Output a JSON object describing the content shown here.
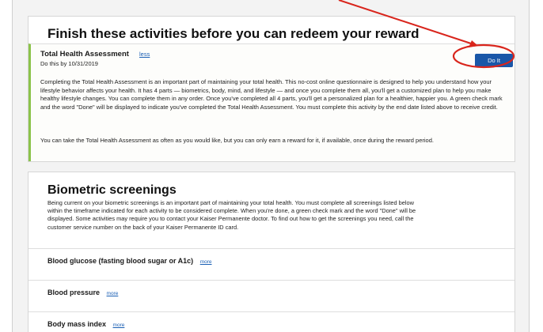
{
  "activities_section": {
    "title": "Finish these activities before you can redeem your reward",
    "activity": {
      "name": "Total Health Assessment",
      "toggle_label": "less",
      "due": "Do this by 10/31/2019",
      "button_label": "Do It",
      "paragraph1": "Completing the Total Health Assessment is an important part of maintaining your total health. This no-cost online questionnaire is designed to help you understand how your lifestyle behavior affects your health. It has 4 parts — biometrics, body, mind, and lifestyle — and once you complete them all, you'll get a customized plan to help you make healthy lifestyle changes. You can complete them in any order. Once you've completed all 4 parts, you'll get a personalized plan for a healthier, happier you. A green check mark and the word \"Done\" will be displayed to indicate you've completed the Total Health Assessment. You must complete this activity by the end date listed above to receive credit.",
      "paragraph2": "You can take the Total Health Assessment as often as you would like, but you can only earn a reward for it, if available, once during the reward period."
    }
  },
  "biometric_section": {
    "title": "Biometric screenings",
    "description": "Being current on your biometric screenings is an important part of maintaining your total health. You must complete all screenings listed below within the timeframe indicated for each activity to be considered complete. When you're done, a green check mark and the word \"Done\" will be displayed. Some activities may require you to contact your Kaiser Permanente doctor. To find out how to get the screenings you need, call the customer service number on the back of your Kaiser Permanente ID card.",
    "items": [
      {
        "label": "Blood glucose (fasting blood sugar or A1c)",
        "more": "more"
      },
      {
        "label": "Blood pressure",
        "more": "more"
      },
      {
        "label": "Body mass index",
        "more": "more"
      }
    ]
  },
  "colors": {
    "accent_green": "#8bc34a",
    "button_blue": "#1a57a8",
    "link_blue": "#1a5fb4",
    "annotation_red": "#d9251c"
  }
}
